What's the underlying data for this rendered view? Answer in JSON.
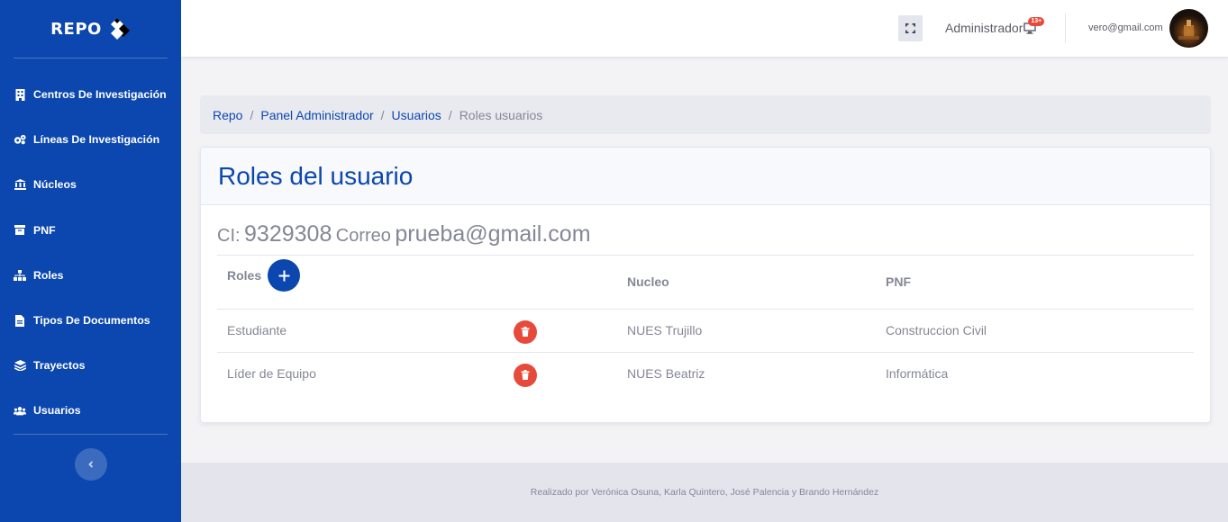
{
  "brand": {
    "name": "REPO",
    "logo_icon": "repo-logo-icon"
  },
  "sidebar": {
    "items": [
      {
        "label": "Centros De Investigación",
        "icon": "building-icon"
      },
      {
        "label": "Líneas De Investigación",
        "icon": "cogs-icon"
      },
      {
        "label": "Núcleos",
        "icon": "university-icon"
      },
      {
        "label": "PNF",
        "icon": "archive-icon"
      },
      {
        "label": "Roles",
        "icon": "sitemap-icon"
      },
      {
        "label": "Tipos De Documentos",
        "icon": "file-icon"
      },
      {
        "label": "Trayectos",
        "icon": "layers-icon"
      },
      {
        "label": "Usuarios",
        "icon": "users-icon"
      }
    ],
    "toggle_icon": "chevron-left-icon"
  },
  "topbar": {
    "fullscreen_icon": "expand-icon",
    "role_label": "Administrador",
    "notification_badge": "13+",
    "user_email": "vero@gmail.com"
  },
  "breadcrumb": {
    "items": [
      "Repo",
      "Panel Administrador",
      "Usuarios"
    ],
    "active": "Roles usuarios"
  },
  "card": {
    "title": "Roles del usuario",
    "ci_label": "CI:",
    "ci_value": "9329308",
    "email_label": "Correo",
    "email_value": "prueba@gmail.com"
  },
  "table": {
    "headers": {
      "roles": "Roles",
      "nucleo": "Nucleo",
      "pnf": "PNF"
    },
    "rows": [
      {
        "role": "Estudiante",
        "nucleo": "NUES Trujillo",
        "pnf": "Construccion Civil"
      },
      {
        "role": "Líder de Equipo",
        "nucleo": "NUES Beatriz",
        "pnf": "Informática"
      }
    ]
  },
  "footer": {
    "text": "Realizado por Verónica Osuna, Karla Quintero, José Palencia y Brando Hernández"
  },
  "colors": {
    "primary": "#0b47ae",
    "danger": "#e74a3b",
    "muted": "#858796"
  }
}
